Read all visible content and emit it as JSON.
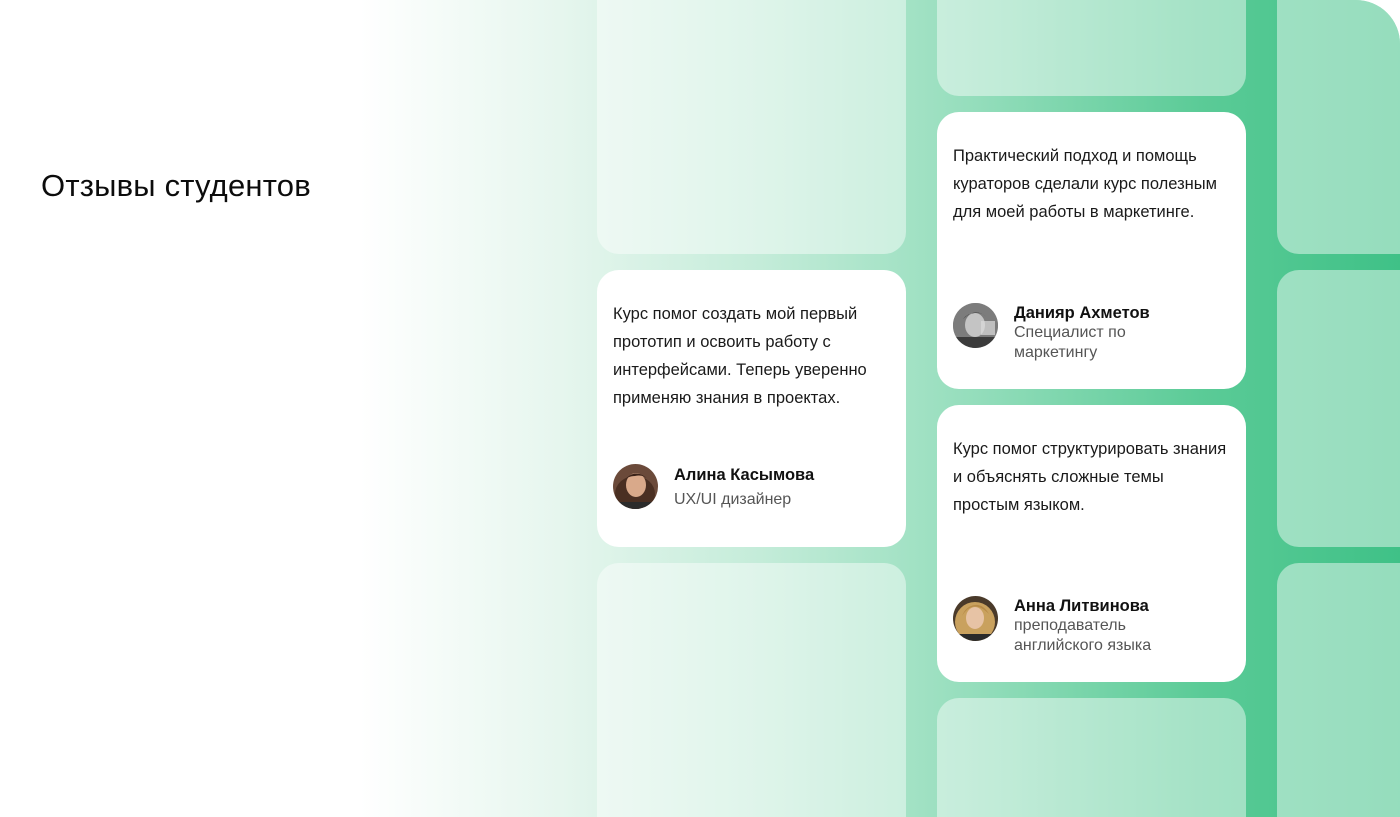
{
  "section": {
    "title": "Отзывы студентов"
  },
  "testimonials": [
    {
      "text": "Курс помог создать мой первый прототип и освоить работу с интерфейсами. Теперь уверенно применяю знания в проектах.",
      "name": "Алина Касымова",
      "role": "UX/UI дизайнер",
      "avatar_icon": "avatar-photo-alina"
    },
    {
      "text": "Практический подход и помощь кураторов сделали курс полезным для моей работы в маркетинге.",
      "name": "Данияр Ахметов",
      "role": "Специалист по маркетингу",
      "avatar_icon": "avatar-photo-daniyar"
    },
    {
      "text": "Курс помог структурировать знания и объяснять сложные темы простым языком.",
      "name": "Анна Литвинова",
      "role": "преподаватель английского языка",
      "avatar_icon": "avatar-photo-anna"
    }
  ],
  "colors": {
    "accent_green": "#3fc187",
    "card_background": "#ffffff"
  }
}
